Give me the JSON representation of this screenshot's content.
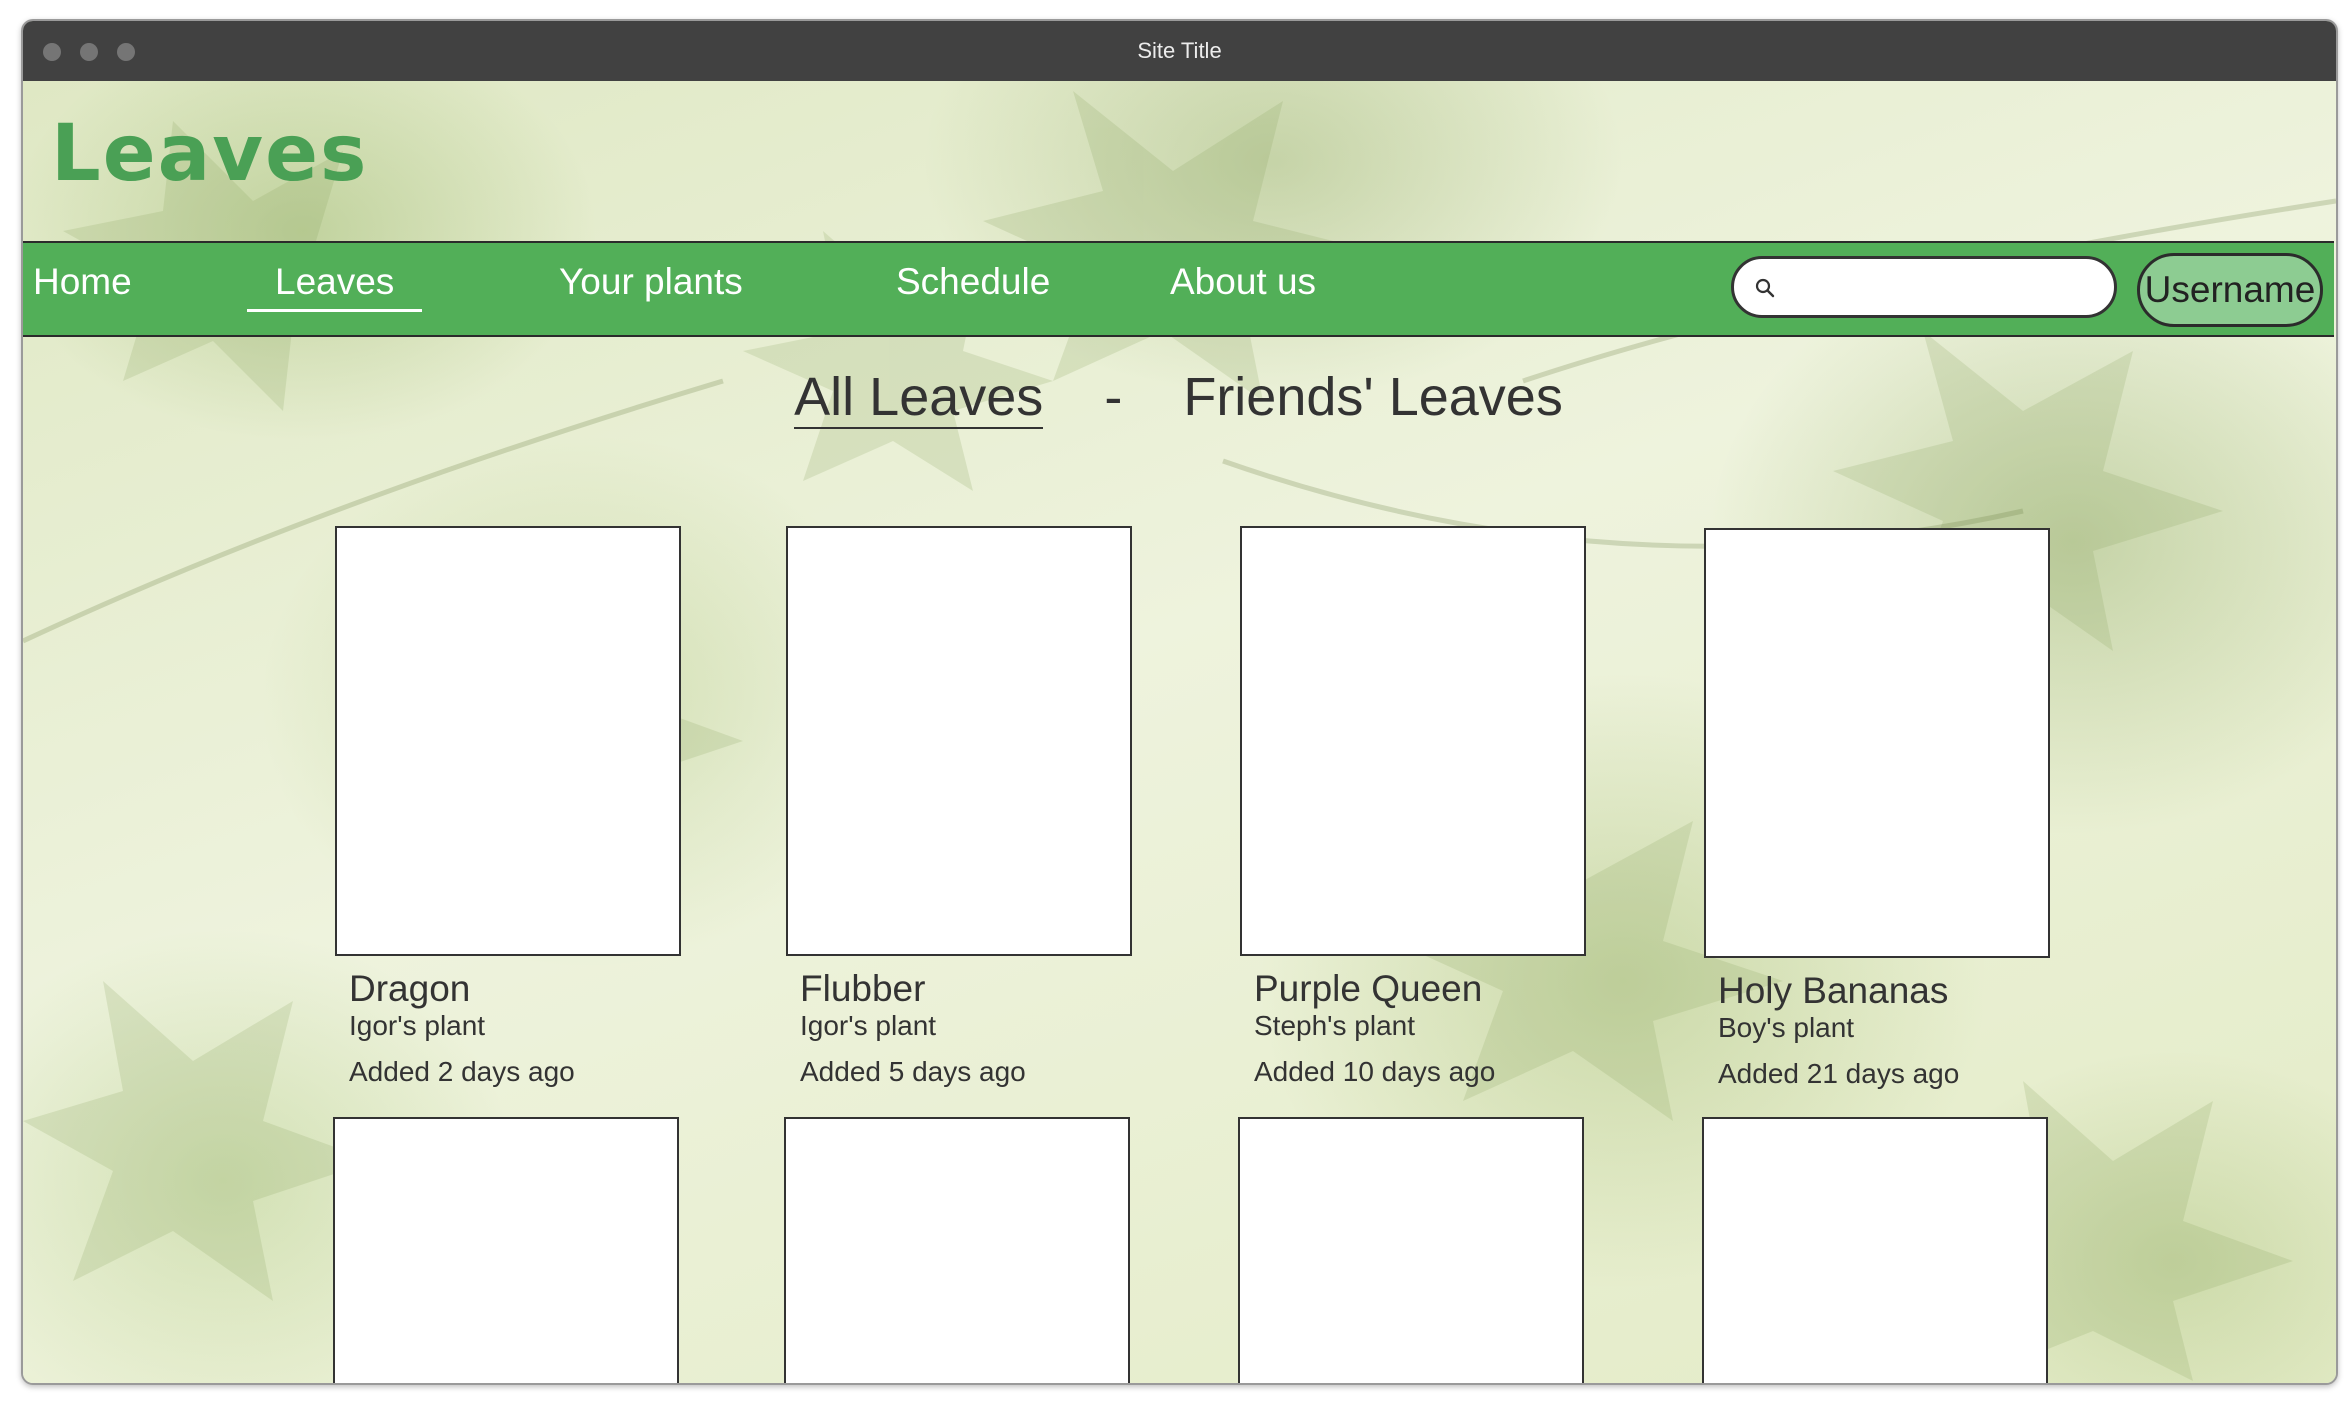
{
  "window": {
    "title": "Site Title"
  },
  "logo": "Leaves",
  "nav": {
    "items": [
      "Home",
      "Leaves",
      "Your plants",
      "Schedule",
      "About us"
    ],
    "active": "Leaves",
    "search_placeholder": "",
    "username": "Username"
  },
  "filter": {
    "all": "All Leaves",
    "separator": "-",
    "friends": "Friends' Leaves",
    "active": "All Leaves"
  },
  "plants": [
    {
      "name": "Dragon",
      "owner": "Igor's plant",
      "added": "Added 2 days ago"
    },
    {
      "name": "Flubber",
      "owner": "Igor's plant",
      "added": "Added 5 days ago"
    },
    {
      "name": "Purple Queen",
      "owner": "Steph's plant",
      "added": "Added 10 days ago"
    },
    {
      "name": "Holy Bananas",
      "owner": "Boy's plant",
      "added": "Added 21 days ago"
    }
  ],
  "colors": {
    "nav_green": "#52af58",
    "logo_green": "#4aa055",
    "username_button": "#8dcc92",
    "titlebar": "#414141"
  },
  "icons": {
    "search": "search-icon"
  }
}
